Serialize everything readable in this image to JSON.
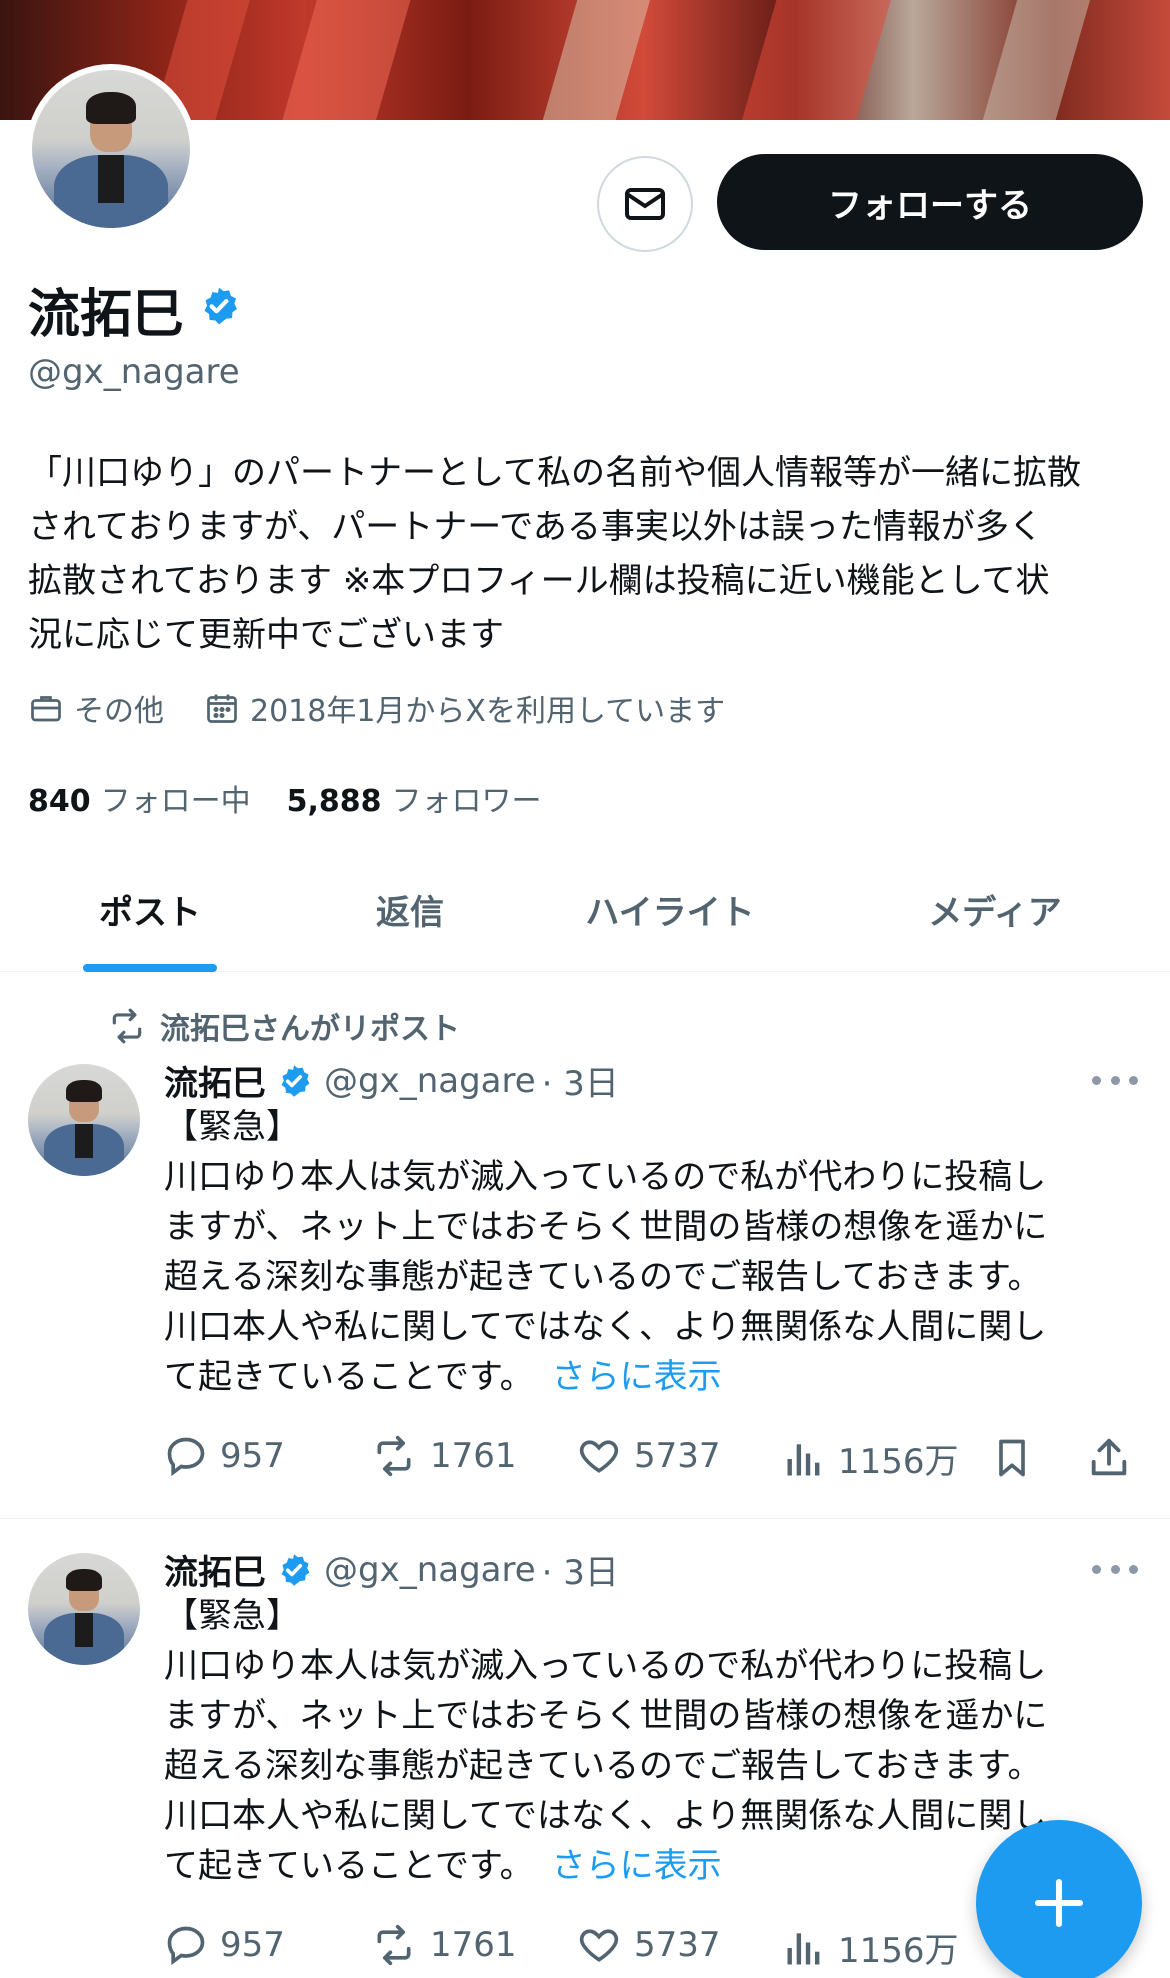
{
  "profile": {
    "name": "流拓巳",
    "handle": "@gx_nagare",
    "bio_lines": [
      "「川口ゆり」のパートナーとして私の名前や個人情報等が一緒に拡散",
      "されておりますが、パートナーである事実以外は誤った情報が多く",
      "拡散されております ※本プロフィール欄は投稿に近い機能として状",
      "況に応じて更新中でございます"
    ],
    "category": "その他",
    "joined": "2018年1月からXを利用しています",
    "following_count": "840",
    "following_label": "フォロー中",
    "followers_count": "5,888",
    "followers_label": "フォロワー"
  },
  "actions": {
    "follow_label": "フォローする",
    "message_icon": "mail-icon"
  },
  "tabs": [
    {
      "label": "ポスト",
      "active": true
    },
    {
      "label": "返信",
      "active": false
    },
    {
      "label": "ハイライト",
      "active": false
    },
    {
      "label": "メディア",
      "active": false
    }
  ],
  "tweets": [
    {
      "repost_label": "流拓巳さんがリポスト",
      "name": "流拓巳",
      "handle": "@gx_nagare",
      "time": "· 3日",
      "lines": [
        "【緊急】",
        "川口ゆり本人は気が滅入っているので私が代わりに投稿し",
        "ますが、ネット上ではおそらく世間の皆様の想像を遥かに",
        "超える深刻な事態が起きているのでご報告しておきます。",
        "川口本人や私に関してではなく、より無関係な人間に関し",
        "て起きていることです。"
      ],
      "show_more": "さらに表示",
      "replies": "957",
      "reposts": "1761",
      "likes": "5737",
      "views": "1156万"
    },
    {
      "repost_label": "",
      "name": "流拓巳",
      "handle": "@gx_nagare",
      "time": "· 3日",
      "lines": [
        "【緊急】",
        "川口ゆり本人は気が滅入っているので私が代わりに投稿し",
        "ますが、ネット上ではおそらく世間の皆様の想像を遥かに",
        "超える深刻な事態が起きているのでご報告しておきます。",
        "川口本人や私に関してではなく、より無関係な人間に関し",
        "て起きていることです。"
      ],
      "show_more": "さらに表示",
      "replies": "957",
      "reposts": "1761",
      "likes": "5737",
      "views": "1156万"
    }
  ],
  "colors": {
    "accent": "#1d9bf0",
    "text": "#0f1419",
    "secondary": "#536471",
    "follow_button": "#0f1419"
  }
}
